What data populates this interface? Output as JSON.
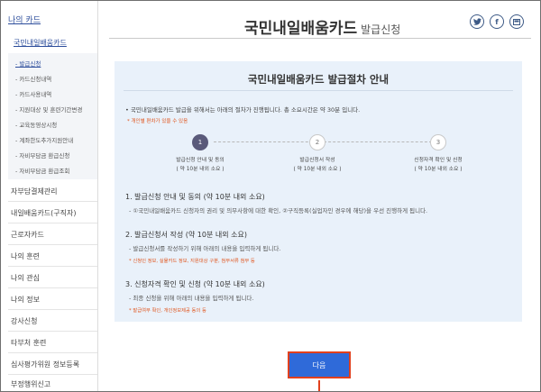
{
  "sidebar": {
    "title": "나의 카드",
    "sub_title": "국민내일배움카드",
    "sub_items": [
      "- 발급신청",
      "- 카드신청내역",
      "- 카드사용내역",
      "- 지원대상 및 훈련기간변경",
      "- 교육동영상시청",
      "- 계좌한도추가지원안내",
      "- 자비부담금 환급신청",
      "- 자비부담금 환급조회"
    ],
    "menu_items": [
      "자부담결제관리",
      "내일배움카드(구직자)",
      "근로자카드",
      "나의 훈련",
      "나의 관심",
      "나의 정보",
      "강사신청",
      "타부처 훈련",
      "심사평가위원 정보등록",
      "부정행위신고"
    ]
  },
  "header": {
    "title": "국민내일배움카드",
    "subtitle": "발급신청",
    "social_icons": [
      "twitter-icon",
      "facebook-icon",
      "bookmark-icon"
    ]
  },
  "card": {
    "title": "국민내일배움카드 발급절차 안내",
    "intro": "• 국민내일배움카드 발급을 위해서는 아래의 절차가 진행됩니다. 총 소요시간은 약 30분 입니다.",
    "note": "* 개인별 편차가 있을 수 있음",
    "steps": [
      {
        "num": "1",
        "label1": "발급신청 안내 및 동의",
        "label2": "( 약 10분 내외 소요 )"
      },
      {
        "num": "2",
        "label1": "발급신청서 작성",
        "label2": "( 약 10분 내외 소요 )"
      },
      {
        "num": "3",
        "label1": "신청자격 확인 및 신청",
        "label2": "( 약 10분 내외 소요 )"
      }
    ],
    "sections": [
      {
        "title": "1. 발급신청 안내 및 동의 (약 10분 내외 소요)",
        "desc": "- ①국민내일배움카드 신청자의 권리 및 의무사항에 대한 확인, ②구직등록(실업자인 경우에 해당)을 우선 진행하게 됩니다.",
        "note": ""
      },
      {
        "title": "2. 발급신청서 작성 (약 10분 내외 소요)",
        "desc": "- 발급신청서를 작성하기 위해 아래의 내용을 입력하게 됩니다.",
        "note": "* 신청인 정보, 실물카드 정보, 지원대상 구분, 첨부서류 첨부 등"
      },
      {
        "title": "3. 신청자격 확인 및 신청 (약 10분 내외 소요)",
        "desc": "- 최종 신청을 위해 아래의 내용을 입력하게 됩니다.",
        "note": "* 발급여부 확인, 개인정보제공 동의 등"
      }
    ]
  },
  "next_label": "다음",
  "colors": {
    "accent": "#2f6ad9",
    "highlight": "#e2401d",
    "note": "#e0541c",
    "panel": "#e9f1fa"
  }
}
